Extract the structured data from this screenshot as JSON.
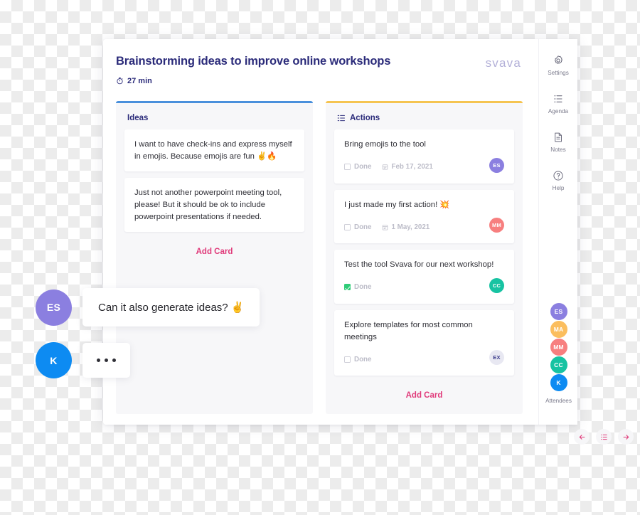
{
  "meeting": {
    "title": "Brainstorming ideas to improve online workshops",
    "timer": "27 min",
    "timer_icon": "stopwatch-icon",
    "logo": "svava"
  },
  "columns": [
    {
      "id": "ideas",
      "label": "Ideas",
      "accent": "#4a90dc",
      "has_icon": false,
      "add_label": "Add Card",
      "cards": [
        {
          "text": "I want to have check-ins and express myself in emojis. Because emojis are fun ✌️🔥"
        },
        {
          "text": "Just not another powerpoint meeting tool, please! But it should be ok to include powerpoint presentations if needed."
        }
      ]
    },
    {
      "id": "actions",
      "label": "Actions",
      "accent": "#f5c451",
      "has_icon": true,
      "icon": "ordered-list-icon",
      "add_label": "Add Card",
      "cards": [
        {
          "text": "Bring emojis to the tool",
          "done_label": "Done",
          "done": false,
          "date": "Feb 17, 2021",
          "avatar": {
            "initials": "ES",
            "color": "#8b7fe0"
          }
        },
        {
          "text": "I just made my first action! 💥",
          "done_label": "Done",
          "done": false,
          "date": "1 May, 2021",
          "avatar": {
            "initials": "MM",
            "color": "#f77f7f"
          }
        },
        {
          "text": "Test the tool Svava for our next workshop!",
          "done_label": "Done",
          "done": true,
          "date": "",
          "avatar": {
            "initials": "CC",
            "color": "#17c3a2"
          }
        },
        {
          "text": "Explore templates for most common meetings",
          "done_label": "Done",
          "done": false,
          "date": "",
          "avatar": {
            "initials": "EX",
            "color": "#e8e8f2",
            "text_color": "#3b3b8c"
          }
        }
      ]
    }
  ],
  "bottom_nav": [
    {
      "name": "previous-button",
      "icon": "arrow-left-icon"
    },
    {
      "name": "overview-button",
      "icon": "list-icon"
    },
    {
      "name": "next-button",
      "icon": "arrow-right-icon"
    }
  ],
  "sidebar": {
    "items": [
      {
        "label": "Settings",
        "icon": "gear-icon"
      },
      {
        "label": "Agenda",
        "icon": "list-icon"
      },
      {
        "label": "Notes",
        "icon": "document-icon"
      },
      {
        "label": "Help",
        "icon": "question-circle-icon"
      }
    ],
    "attendees_label": "Attendees",
    "attendees": [
      {
        "initials": "ES",
        "color": "#8b7fe0"
      },
      {
        "initials": "MA",
        "color": "#fbbe5e"
      },
      {
        "initials": "MM",
        "color": "#f77f7f"
      },
      {
        "initials": "CC",
        "color": "#17c3a2"
      },
      {
        "initials": "K",
        "color": "#0d8bf2"
      }
    ]
  },
  "chat": [
    {
      "avatar": {
        "initials": "ES",
        "color": "#8b7fe0"
      },
      "message": "Can it also generate ideas? ✌️",
      "typing": false
    },
    {
      "avatar": {
        "initials": "K",
        "color": "#0d8bf2"
      },
      "message": "",
      "typing": true
    }
  ],
  "colors": {
    "title": "#2b2b7a",
    "accent_pink": "#e03a7a",
    "ideas_border": "#4a90dc",
    "actions_border": "#f5c451",
    "done_green": "#2fcc78",
    "logo": "#b3b0d8"
  }
}
